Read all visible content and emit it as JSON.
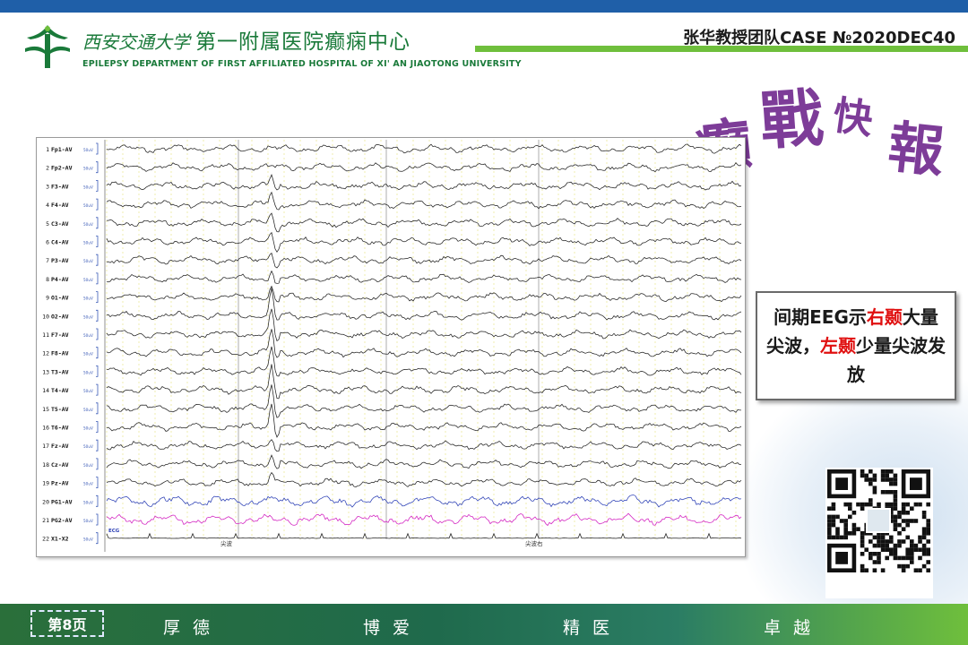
{
  "header": {
    "university_cn": "西安交通大学",
    "department_cn": "第一附属医院癫痫中心",
    "department_en": "EPILEPSY DEPARTMENT OF FIRST AFFILIATED HOSPITAL OF XI' AN JIAOTONG UNIVERSITY",
    "case_label": "张华教授团队CASE №2020DEC40"
  },
  "brand_art": {
    "text": [
      "癫",
      "戰",
      "快",
      "報"
    ],
    "color": "#7d3c98"
  },
  "eeg": {
    "channels": [
      {
        "index": "1",
        "label": "Fp1-AV"
      },
      {
        "index": "2",
        "label": "Fp2-AV"
      },
      {
        "index": "3",
        "label": "F3-AV"
      },
      {
        "index": "4",
        "label": "F4-AV"
      },
      {
        "index": "5",
        "label": "C3-AV"
      },
      {
        "index": "6",
        "label": "C4-AV"
      },
      {
        "index": "7",
        "label": "P3-AV"
      },
      {
        "index": "8",
        "label": "P4-AV"
      },
      {
        "index": "9",
        "label": "O1-AV"
      },
      {
        "index": "10",
        "label": "O2-AV"
      },
      {
        "index": "11",
        "label": "F7-AV"
      },
      {
        "index": "12",
        "label": "F8-AV"
      },
      {
        "index": "13",
        "label": "T3-AV"
      },
      {
        "index": "14",
        "label": "T4-AV"
      },
      {
        "index": "15",
        "label": "T5-AV"
      },
      {
        "index": "16",
        "label": "T6-AV"
      },
      {
        "index": "17",
        "label": "Fz-AV"
      },
      {
        "index": "18",
        "label": "Cz-AV"
      },
      {
        "index": "19",
        "label": "Pz-AV"
      },
      {
        "index": "20",
        "label": "PG1-AV"
      },
      {
        "index": "21",
        "label": "PG2-AV"
      },
      {
        "index": "22",
        "label": "X1-X2"
      }
    ],
    "scale_label": "50uV",
    "ecg_label": "ECG",
    "annotations": [
      "尖波",
      "尖波右"
    ],
    "trace_colors": {
      "default": "#222222",
      "pg1": "#2b3fb5",
      "pg2": "#d21fc0",
      "grid": "#e4e07a"
    }
  },
  "callout": {
    "parts": [
      {
        "text": "间期EEG示",
        "red": false
      },
      {
        "text": "右颞",
        "red": true
      },
      {
        "text": "大量尖波，",
        "red": false
      },
      {
        "text": "左颞",
        "red": true
      },
      {
        "text": "少量尖波发放",
        "red": false
      }
    ]
  },
  "footer": {
    "page_label": "第8页",
    "mottos": [
      "厚德",
      "博爱",
      "精医",
      "卓越"
    ]
  }
}
